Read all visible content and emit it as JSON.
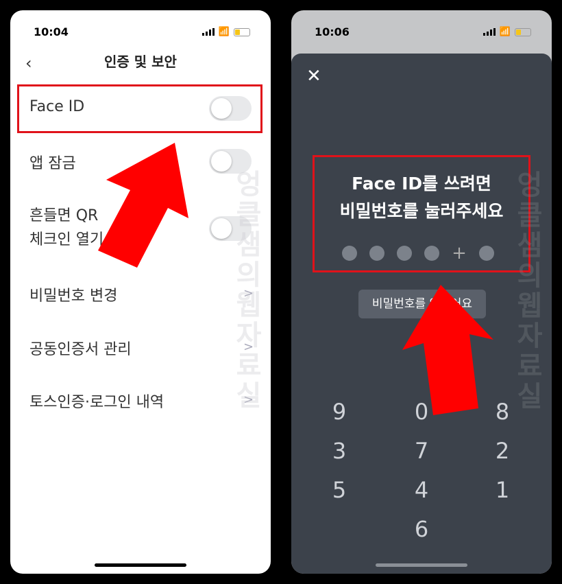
{
  "left": {
    "time": "10:04",
    "title": "인증 및 보안",
    "back_icon": "chevron-left-icon",
    "items": [
      {
        "label": "Face ID",
        "control": "toggle",
        "on": false
      },
      {
        "label": "앱 잠금",
        "control": "toggle",
        "on": false
      },
      {
        "label": "흔들면 QR\n체크인 열기",
        "control": "toggle",
        "on": false
      },
      {
        "label": "비밀번호 변경",
        "control": "chevron"
      },
      {
        "label": "공동인증서 관리",
        "control": "chevron"
      },
      {
        "label": "토스인증·로그인 내역",
        "control": "chevron"
      }
    ]
  },
  "right": {
    "time": "10:06",
    "close_icon": "close-icon",
    "title_line1": "Face ID를 쓰려면",
    "title_line2": "비밀번호를 눌러주세요",
    "forgot_label": "비밀번호를 잊었어요",
    "keys": [
      "9",
      "0",
      "8",
      "3",
      "7",
      "2",
      "5",
      "4",
      "1",
      "6"
    ]
  },
  "watermark": "엉클샘의웹자료실",
  "colors": {
    "highlight": "#e0121a",
    "arrow": "#ff0000",
    "sheet": "#3c424b"
  }
}
